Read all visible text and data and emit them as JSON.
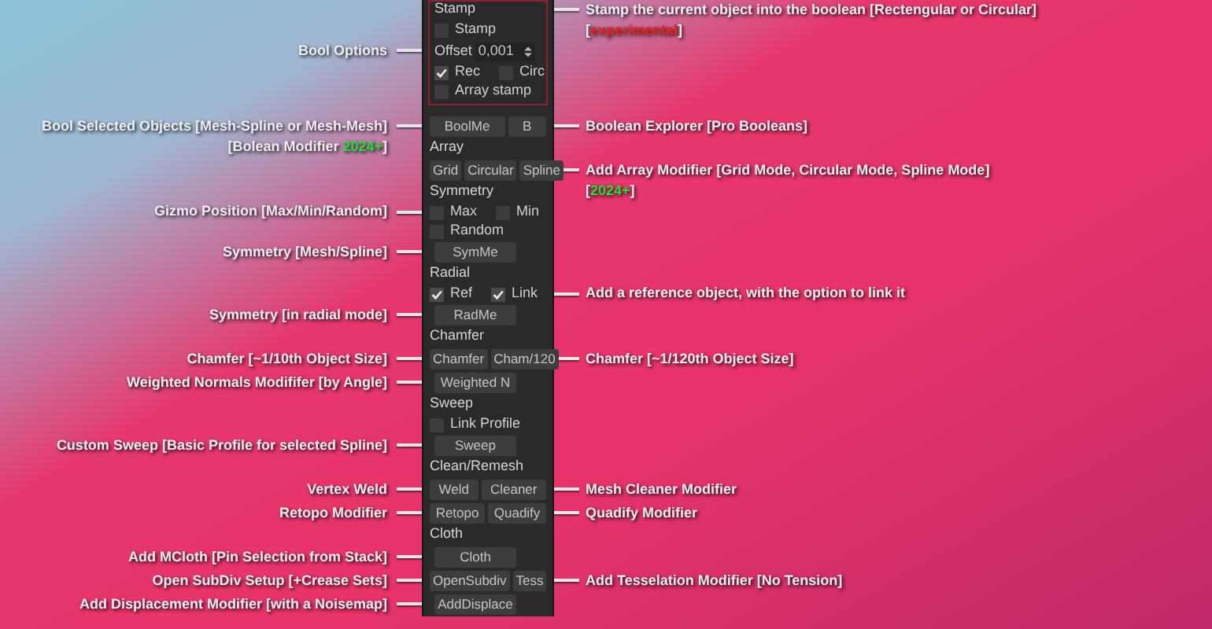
{
  "panel": {
    "sections": [
      {
        "kind": "boxed",
        "rows": [
          {
            "kind": "title",
            "text": "Stamp",
            "right": [
              [
                {
                  "text": "Stamp the current object into the boolean [Rectengular or Circular]"
                }
              ],
              [
                {
                  "text": "["
                },
                {
                  "text": "experimental",
                  "color": "#e8201c"
                },
                {
                  "text": "]"
                }
              ]
            ]
          },
          {
            "kind": "checkboxes",
            "items": [
              {
                "label": "Stamp",
                "checked": false
              }
            ]
          },
          {
            "kind": "spinner",
            "label": "Offset",
            "value": "0,001",
            "left": [
              [
                {
                  "text": "Bool Options"
                }
              ]
            ]
          },
          {
            "kind": "checkboxes",
            "items": [
              {
                "label": "Rec",
                "checked": true
              },
              {
                "label": "Circ",
                "checked": false
              }
            ]
          },
          {
            "kind": "checkboxes",
            "items": [
              {
                "label": "Array stamp",
                "checked": false
              }
            ]
          }
        ]
      },
      {
        "kind": "plain",
        "rows": [
          {
            "kind": "buttons",
            "items": [
              {
                "label": "BoolMe"
              },
              {
                "label": "B"
              }
            ],
            "left": [
              [
                {
                  "text": "Bool Selected Objects [Mesh-Spline or Mesh-Mesh]"
                }
              ],
              [
                {
                  "text": "[Bolean Modifier "
                },
                {
                  "text": "2024+",
                  "color": "#22dd33"
                },
                {
                  "text": "]"
                }
              ]
            ],
            "right": [
              [
                {
                  "text": "Boolean Explorer [Pro Booleans]"
                }
              ]
            ]
          },
          {
            "kind": "title",
            "text": "Array"
          },
          {
            "kind": "buttons",
            "items": [
              {
                "label": "Grid"
              },
              {
                "label": "Circular"
              },
              {
                "label": "Spline"
              }
            ],
            "right": [
              [
                {
                  "text": "Add Array Modifier [Grid Mode, Circular Mode, Spline Mode]"
                }
              ],
              [
                {
                  "text": "["
                },
                {
                  "text": "2024+",
                  "color": "#22dd33"
                },
                {
                  "text": "]"
                }
              ]
            ]
          },
          {
            "kind": "title",
            "text": "Symmetry"
          },
          {
            "kind": "checkboxes",
            "items": [
              {
                "label": "Max",
                "checked": false
              },
              {
                "label": "Min",
                "checked": false
              }
            ],
            "left": [
              [
                {
                  "text": "Gizmo Position [Max/Min/Random]"
                }
              ]
            ]
          },
          {
            "kind": "checkboxes",
            "items": [
              {
                "label": "Random",
                "checked": false
              }
            ]
          },
          {
            "kind": "buttons",
            "items": [
              {
                "label": "SymMe"
              }
            ],
            "left": [
              [
                {
                  "text": "Symmetry [Mesh/Spline]"
                }
              ]
            ]
          },
          {
            "kind": "title",
            "text": "Radial"
          },
          {
            "kind": "checkboxes",
            "items": [
              {
                "label": "Ref",
                "checked": true
              },
              {
                "label": "Link",
                "checked": true
              }
            ],
            "right": [
              [
                {
                  "text": "Add a reference object, with the option to link it"
                }
              ]
            ]
          },
          {
            "kind": "buttons",
            "items": [
              {
                "label": "RadMe"
              }
            ],
            "left": [
              [
                {
                  "text": "Symmetry [in radial mode]"
                }
              ]
            ]
          },
          {
            "kind": "title",
            "text": "Chamfer"
          },
          {
            "kind": "buttons",
            "items": [
              {
                "label": "Chamfer"
              },
              {
                "label": "Cham/120"
              }
            ],
            "left": [
              [
                {
                  "text": "Chamfer [~1/10th Object Size]"
                }
              ]
            ],
            "right": [
              [
                {
                  "text": "Chamfer [~1/120th Object Size]"
                }
              ]
            ]
          },
          {
            "kind": "buttons",
            "items": [
              {
                "label": "Weighted N"
              }
            ],
            "left": [
              [
                {
                  "text": "Weighted Normals Modififer [by Angle]"
                }
              ]
            ]
          },
          {
            "kind": "title",
            "text": "Sweep"
          },
          {
            "kind": "checkboxes",
            "items": [
              {
                "label": "Link Profile",
                "checked": false
              }
            ]
          },
          {
            "kind": "buttons",
            "items": [
              {
                "label": "Sweep"
              }
            ],
            "left": [
              [
                {
                  "text": "Custom Sweep  [Basic Profile for selected Spline]"
                }
              ]
            ]
          },
          {
            "kind": "title",
            "text": "Clean/Remesh"
          },
          {
            "kind": "buttons",
            "items": [
              {
                "label": "Weld"
              },
              {
                "label": "Cleaner"
              }
            ],
            "left": [
              [
                {
                  "text": "Vertex Weld"
                }
              ]
            ],
            "right": [
              [
                {
                  "text": "Mesh Cleaner Modifier"
                }
              ]
            ]
          },
          {
            "kind": "buttons",
            "items": [
              {
                "label": "Retopo"
              },
              {
                "label": "Quadify"
              }
            ],
            "left": [
              [
                {
                  "text": "Retopo Modifier"
                }
              ]
            ],
            "right": [
              [
                {
                  "text": "Quadify Modifier"
                }
              ]
            ]
          },
          {
            "kind": "title",
            "text": "Cloth"
          },
          {
            "kind": "buttons",
            "items": [
              {
                "label": "Cloth"
              }
            ],
            "left": [
              [
                {
                  "text": "Add MCloth [Pin Selection from Stack]"
                }
              ]
            ]
          },
          {
            "kind": "buttons",
            "items": [
              {
                "label": "OpenSubdiv"
              },
              {
                "label": "Tess"
              }
            ],
            "left": [
              [
                {
                  "text": "Open SubDiv Setup [+Crease Sets]"
                }
              ]
            ],
            "right": [
              [
                {
                  "text": "Add Tesselation Modifier [No Tension]"
                }
              ]
            ]
          },
          {
            "kind": "buttons",
            "items": [
              {
                "label": "AddDisplace"
              }
            ],
            "left": [
              [
                {
                  "text": "Add Displacement Modifier [with a Noisemap]"
                }
              ]
            ]
          }
        ]
      }
    ]
  }
}
